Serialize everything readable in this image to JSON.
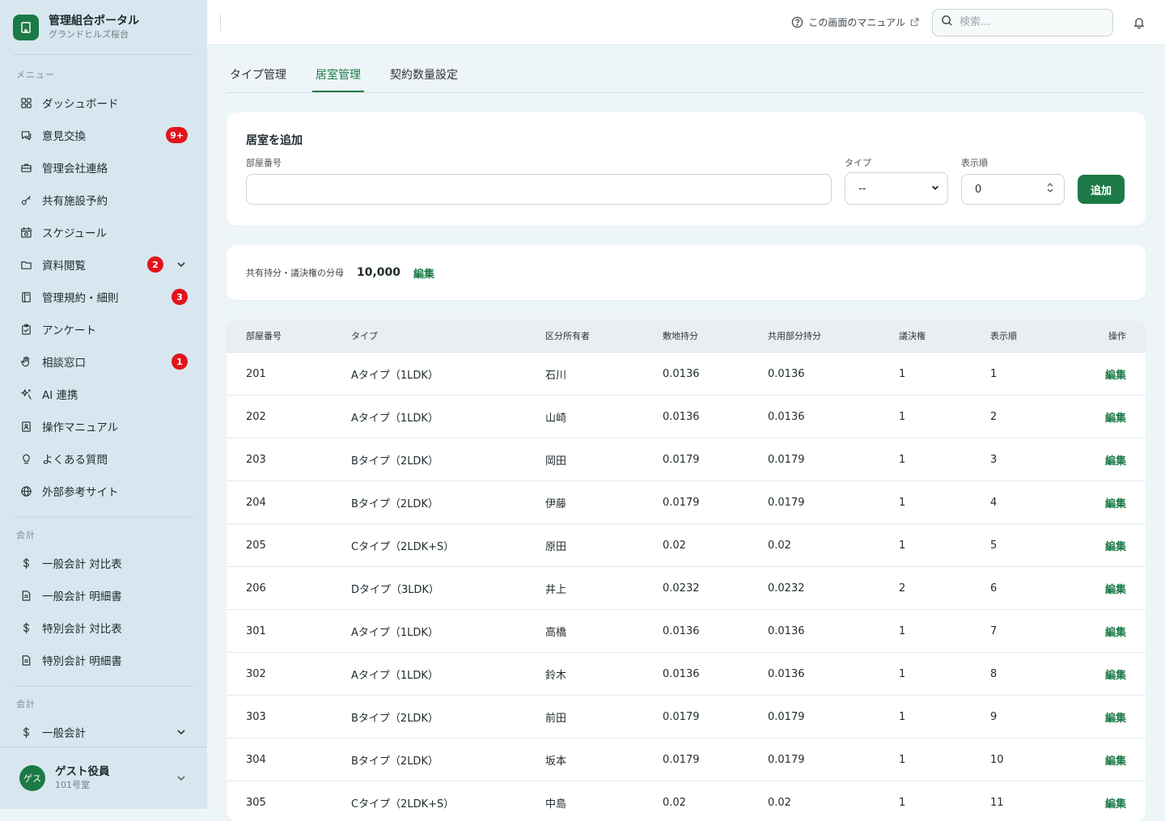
{
  "brand": {
    "title": "管理組合ポータル",
    "subtitle": "グランドヒルズ桜台"
  },
  "sidebar": {
    "menu_label": "メニュー",
    "items": [
      {
        "label": "ダッシュボード",
        "icon": "dashboard-icon"
      },
      {
        "label": "意見交換",
        "icon": "chat-icon",
        "badge": "9+"
      },
      {
        "label": "管理会社連絡",
        "icon": "briefcase-icon"
      },
      {
        "label": "共有施設予約",
        "icon": "key-icon"
      },
      {
        "label": "スケジュール",
        "icon": "calendar-icon"
      },
      {
        "label": "資料閲覧",
        "icon": "folder-icon",
        "badge": "2",
        "expandable": true
      },
      {
        "label": "管理規約・細則",
        "icon": "book-icon",
        "badge": "3"
      },
      {
        "label": "アンケート",
        "icon": "clipboard-icon"
      },
      {
        "label": "相談窓口",
        "icon": "hand-icon",
        "badge": "1"
      },
      {
        "label": "AI 連携",
        "icon": "sparkle-icon"
      },
      {
        "label": "操作マニュアル",
        "icon": "manual-icon"
      },
      {
        "label": "よくある質問",
        "icon": "lightbulb-icon"
      },
      {
        "label": "外部参考サイト",
        "icon": "globe-icon"
      }
    ],
    "accounting_label": "会計",
    "accounting_items": [
      {
        "label": "一般会計 対比表",
        "icon": "dollar-icon"
      },
      {
        "label": "一般会計 明細書",
        "icon": "document-icon"
      },
      {
        "label": "特別会計 対比表",
        "icon": "dollar-icon"
      },
      {
        "label": "特別会計 明細書",
        "icon": "document-icon"
      }
    ],
    "accounting2_label": "会計",
    "accounting2_items": [
      {
        "label": "一般会計",
        "icon": "dollar-icon",
        "expandable": true
      }
    ]
  },
  "user": {
    "avatar": "ゲス",
    "name": "ゲスト役員",
    "room": "101号室"
  },
  "topbar": {
    "manual_link": "この画面のマニュアル",
    "search_placeholder": "検索..."
  },
  "tabs": [
    {
      "label": "タイプ管理",
      "active": false
    },
    {
      "label": "居室管理",
      "active": true
    },
    {
      "label": "契約数量設定",
      "active": false
    }
  ],
  "add_form": {
    "title": "居室を追加",
    "room_label": "部屋番号",
    "room_value": "",
    "type_label": "タイプ",
    "type_value": "--",
    "order_label": "表示順",
    "order_value": "0",
    "add_button": "追加"
  },
  "ratio": {
    "label": "共有持分・議決権の分母",
    "value": "10,000",
    "edit": "編集"
  },
  "table": {
    "headers": [
      "部屋番号",
      "タイプ",
      "区分所有者",
      "敷地持分",
      "共用部分持分",
      "議決権",
      "表示順",
      "操作"
    ],
    "rows": [
      [
        "201",
        "Aタイプ（1LDK）",
        "石川",
        "0.0136",
        "0.0136",
        "1",
        "1",
        "編集"
      ],
      [
        "202",
        "Aタイプ（1LDK）",
        "山崎",
        "0.0136",
        "0.0136",
        "1",
        "2",
        "編集"
      ],
      [
        "203",
        "Bタイプ（2LDK）",
        "岡田",
        "0.0179",
        "0.0179",
        "1",
        "3",
        "編集"
      ],
      [
        "204",
        "Bタイプ（2LDK）",
        "伊藤",
        "0.0179",
        "0.0179",
        "1",
        "4",
        "編集"
      ],
      [
        "205",
        "Cタイプ（2LDK+S）",
        "原田",
        "0.02",
        "0.02",
        "1",
        "5",
        "編集"
      ],
      [
        "206",
        "Dタイプ（3LDK）",
        "井上",
        "0.0232",
        "0.0232",
        "2",
        "6",
        "編集"
      ],
      [
        "301",
        "Aタイプ（1LDK）",
        "高橋",
        "0.0136",
        "0.0136",
        "1",
        "7",
        "編集"
      ],
      [
        "302",
        "Aタイプ（1LDK）",
        "鈴木",
        "0.0136",
        "0.0136",
        "1",
        "8",
        "編集"
      ],
      [
        "303",
        "Bタイプ（2LDK）",
        "前田",
        "0.0179",
        "0.0179",
        "1",
        "9",
        "編集"
      ],
      [
        "304",
        "Bタイプ（2LDK）",
        "坂本",
        "0.0179",
        "0.0179",
        "1",
        "10",
        "編集"
      ],
      [
        "305",
        "Cタイプ（2LDK+S）",
        "中島",
        "0.02",
        "0.02",
        "1",
        "11",
        "編集"
      ]
    ]
  },
  "colors": {
    "accent": "#1b7a46",
    "badge": "#e3141b",
    "sidebar_bg": "#d8e7ef"
  }
}
